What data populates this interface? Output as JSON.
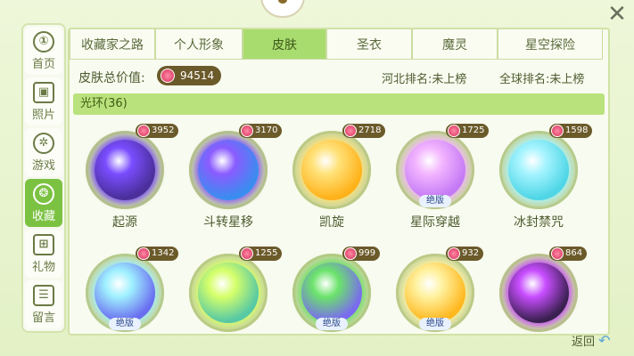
{
  "close_icon": "close-icon",
  "sidebar": [
    {
      "label": "首页",
      "icon": "home-icon",
      "glyph": "①",
      "active": false
    },
    {
      "label": "照片",
      "icon": "photo-icon",
      "glyph": "▣",
      "active": false
    },
    {
      "label": "游戏",
      "icon": "atom-icon",
      "glyph": "✲",
      "active": false
    },
    {
      "label": "收藏",
      "icon": "collection-icon",
      "glyph": "❂",
      "active": true
    },
    {
      "label": "礼物",
      "icon": "gift-icon",
      "glyph": "⊞",
      "active": false
    },
    {
      "label": "留言",
      "icon": "message-icon",
      "glyph": "☰",
      "active": false
    }
  ],
  "tabs": [
    {
      "label": "收藏家之路",
      "active": false
    },
    {
      "label": "个人形象",
      "active": false
    },
    {
      "label": "皮肤",
      "active": true
    },
    {
      "label": "圣衣",
      "active": false
    },
    {
      "label": "魔灵",
      "active": false
    },
    {
      "label": "星空探险",
      "active": false
    }
  ],
  "summary": {
    "label": "皮肤总价值:",
    "value": "94514",
    "province_rank": "河北排名:未上榜",
    "global_rank": "全球排名:未上榜"
  },
  "section": {
    "title": "光环(36)"
  },
  "items": [
    {
      "name": "起源",
      "price": "3952",
      "limited": "",
      "orb": "#4b2f9a",
      "glow": "#7a4dff"
    },
    {
      "name": "斗转星移",
      "price": "3170",
      "limited": "",
      "orb": "#3a8df0",
      "glow": "#8a5cff"
    },
    {
      "name": "凯旋",
      "price": "2718",
      "limited": "",
      "orb": "#ffb21a",
      "glow": "#ffe27a"
    },
    {
      "name": "星际穿越",
      "price": "1725",
      "limited": "绝版",
      "orb": "#c57af5",
      "glow": "#f3b5ff"
    },
    {
      "name": "冰封禁咒",
      "price": "1598",
      "limited": "",
      "orb": "#4fd6e6",
      "glow": "#a6f4ff"
    },
    {
      "name": "",
      "price": "1342",
      "limited": "绝版",
      "orb": "#6a6ef0",
      "glow": "#9ff0ff"
    },
    {
      "name": "",
      "price": "1255",
      "limited": "",
      "orb": "#57c9a4",
      "glow": "#d6ff6a"
    },
    {
      "name": "",
      "price": "999",
      "limited": "绝版",
      "orb": "#7a6af0",
      "glow": "#6be36b"
    },
    {
      "name": "",
      "price": "932",
      "limited": "绝版",
      "orb": "#ffb820",
      "glow": "#fff2a0"
    },
    {
      "name": "",
      "price": "864",
      "limited": "",
      "orb": "#3a2050",
      "glow": "#c84dff"
    }
  ],
  "back": {
    "label": "返回",
    "icon": "back-arrow-icon"
  }
}
